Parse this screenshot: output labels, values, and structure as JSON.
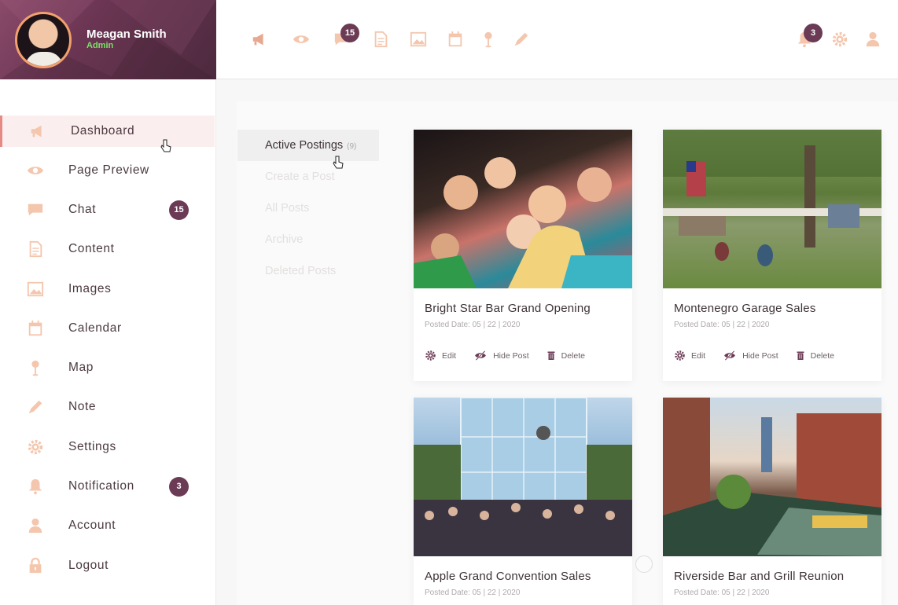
{
  "profile": {
    "name": "Meagan Smith",
    "role": "Admin"
  },
  "topbar": {
    "icons": [
      "megaphone-icon",
      "eye-icon",
      "chat-icon",
      "document-icon",
      "image-icon",
      "calendar-icon",
      "map-pin-icon",
      "pencil-icon"
    ],
    "chat_badge": "15",
    "notification_badge": "3",
    "right_icons": [
      "bell-icon",
      "gear-icon",
      "user-icon"
    ]
  },
  "sidebar": {
    "items": [
      {
        "label": "Dashboard",
        "icon": "megaphone-icon",
        "active": true
      },
      {
        "label": "Page Preview",
        "icon": "eye-icon"
      },
      {
        "label": "Chat",
        "icon": "chat-icon",
        "badge": "15"
      },
      {
        "label": "Content",
        "icon": "document-icon"
      },
      {
        "label": "Images",
        "icon": "image-icon"
      },
      {
        "label": "Calendar",
        "icon": "calendar-icon"
      },
      {
        "label": "Map",
        "icon": "map-pin-icon"
      },
      {
        "label": "Note",
        "icon": "pencil-icon"
      },
      {
        "label": "Settings",
        "icon": "gear-icon"
      },
      {
        "label": "Notification",
        "icon": "bell-icon",
        "badge": "3"
      },
      {
        "label": "Account",
        "icon": "user-icon"
      },
      {
        "label": "Logout",
        "icon": "lock-icon"
      }
    ]
  },
  "subnav": {
    "items": [
      {
        "label": "Active Postings",
        "count": "(9)",
        "active": true
      },
      {
        "label": "Create a Post"
      },
      {
        "label": "All Posts"
      },
      {
        "label": "Archive"
      },
      {
        "label": "Deleted Posts"
      }
    ]
  },
  "posts": [
    {
      "title": "Bright Star Bar Grand Opening",
      "date": "Posted Date: 05 | 22 | 2020",
      "edit": "Edit",
      "hide": "Hide Post",
      "delete": "Delete"
    },
    {
      "title": "Montenegro Garage Sales",
      "date": "Posted Date: 05 | 22 | 2020",
      "edit": "Edit",
      "hide": "Hide Post",
      "delete": "Delete"
    },
    {
      "title": "Apple Grand Convention Sales",
      "date": "Posted Date: 05 | 22 | 2020"
    },
    {
      "title": "Riverside Bar and Grill Reunion",
      "date": "Posted Date: 05 | 22 | 2020"
    }
  ],
  "colors": {
    "icon": "#f4c6ad",
    "accent": "#6b3a55",
    "active_bg": "#fbeeee",
    "active_border": "#e38b84",
    "admin": "#7ee06a"
  }
}
